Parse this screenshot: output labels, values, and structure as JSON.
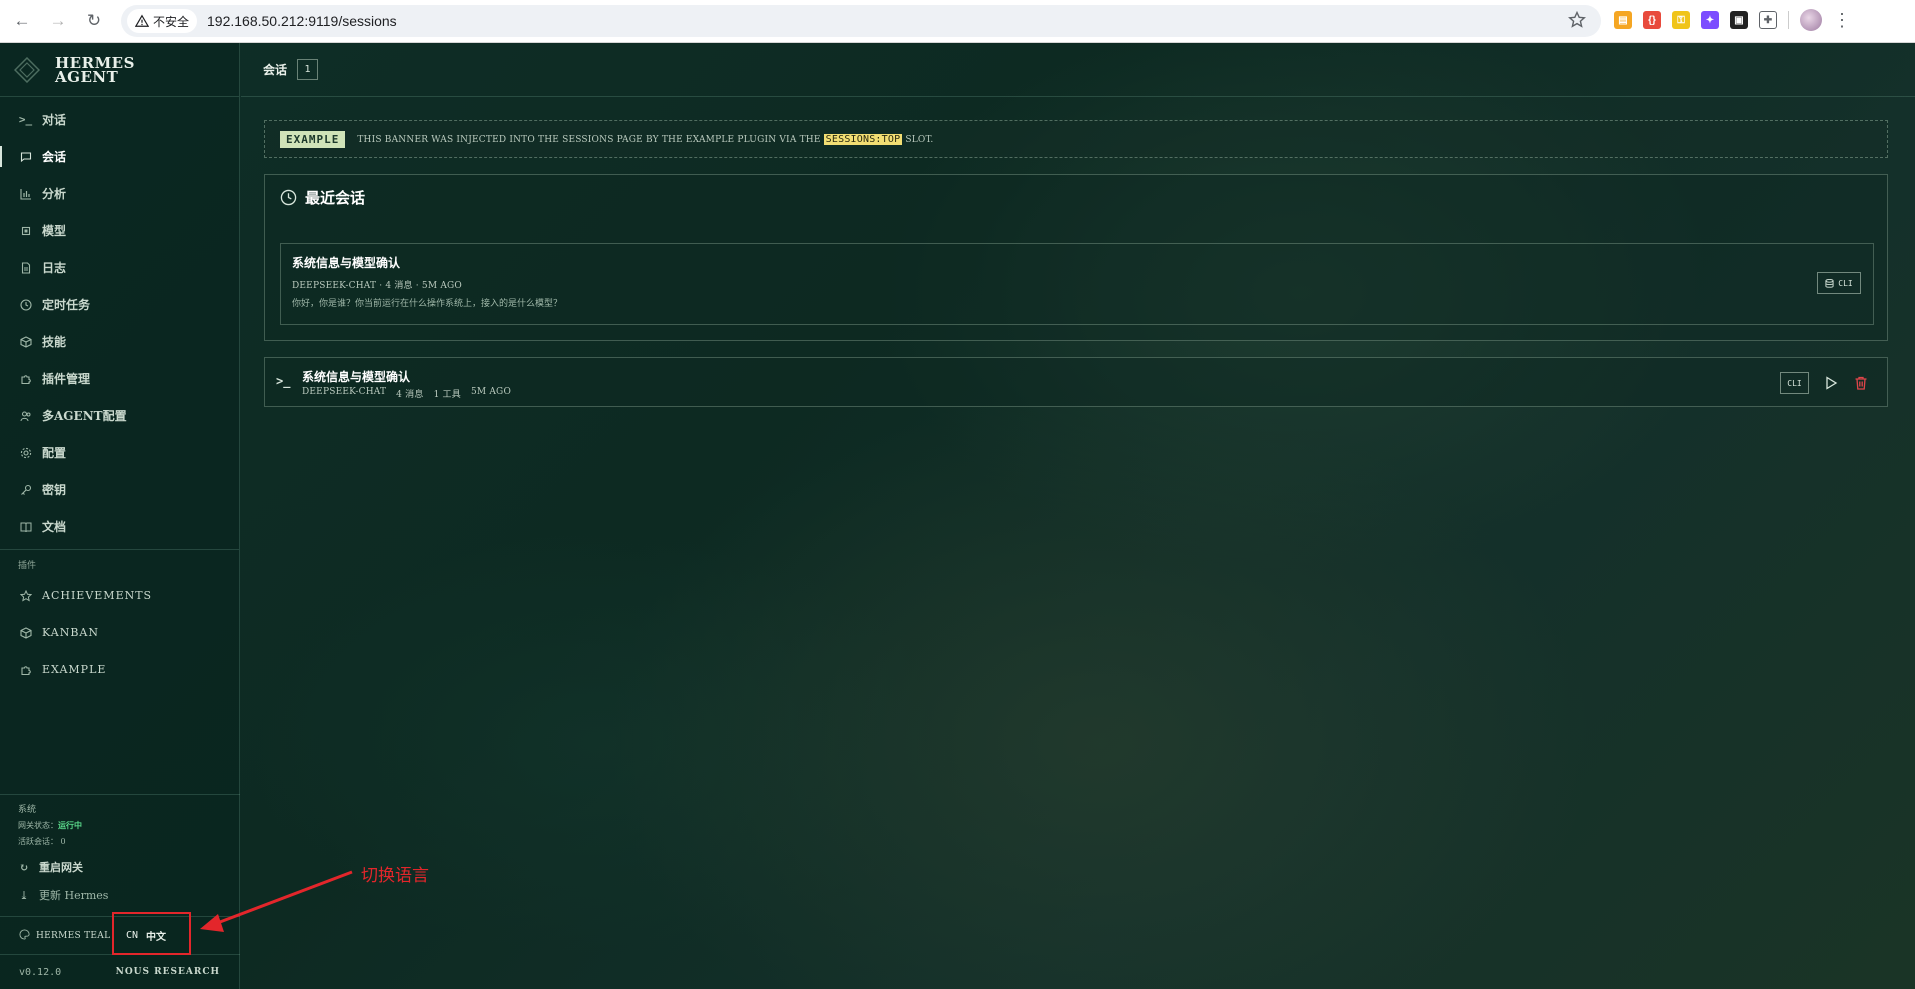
{
  "browser": {
    "security_label": "不安全",
    "url": "192.168.50.212:9119/sessions"
  },
  "brand": {
    "line1": "HERMES",
    "line2": "AGENT"
  },
  "sidebar": {
    "items": [
      {
        "label": "对话",
        "icon": "terminal-icon"
      },
      {
        "label": "会话",
        "icon": "chat-icon"
      },
      {
        "label": "分析",
        "icon": "bar-chart-icon"
      },
      {
        "label": "模型",
        "icon": "cpu-icon"
      },
      {
        "label": "日志",
        "icon": "file-text-icon"
      },
      {
        "label": "定时任务",
        "icon": "clock-icon"
      },
      {
        "label": "技能",
        "icon": "package-icon"
      },
      {
        "label": "插件管理",
        "icon": "puzzle-icon"
      },
      {
        "label": "多AGENT配置",
        "icon": "users-icon"
      },
      {
        "label": "配置",
        "icon": "gear-icon"
      },
      {
        "label": "密钥",
        "icon": "key-icon"
      },
      {
        "label": "文档",
        "icon": "book-icon"
      }
    ],
    "active_index": 1,
    "plugins_label": "插件",
    "plugins": [
      {
        "label": "ACHIEVEMENTS",
        "icon": "star-icon"
      },
      {
        "label": "KANBAN",
        "icon": "package-icon"
      },
      {
        "label": "EXAMPLE",
        "icon": "puzzle-icon"
      }
    ],
    "system": {
      "title": "系统",
      "gateway_label": "网关状态：",
      "gateway_status": "运行中",
      "active_sessions_label": "活跃会话：",
      "active_sessions": "0",
      "restart_label": "重启网关",
      "update_label": "更新 Hermes"
    },
    "theme_label": "HERMES TEAL",
    "lang_code": "CN",
    "lang_label": "中文",
    "version": "v0.12.0",
    "org": "NOUS RESEARCH"
  },
  "topbar": {
    "title": "会话",
    "count": "1"
  },
  "banner": {
    "tag": "EXAMPLE",
    "text_before": "THIS BANNER WAS INJECTED INTO THE SESSIONS PAGE BY THE EXAMPLE PLUGIN VIA THE",
    "slot": "SESSIONS:TOP",
    "text_after": "SLOT."
  },
  "recent": {
    "heading": "最近会话",
    "item": {
      "title": "系统信息与模型确认",
      "meta": "DEEPSEEK-CHAT · 4 消息 · 5M AGO",
      "preview": "你好，你是谁？你当前运行在什么操作系统上，接入的是什么模型？",
      "cli_label": "CLI"
    }
  },
  "sessions": [
    {
      "title": "系统信息与模型确认",
      "model": "DEEPSEEK-CHAT",
      "messages": "4 消息",
      "tools": "1 工具",
      "age": "5M AGO",
      "cli_label": "CLI"
    }
  ],
  "annotation": {
    "text": "切换语言",
    "color": "#e3262b"
  },
  "colors": {
    "accent": "#5bd98b",
    "slot_highlight": "#f2de73",
    "danger": "#e0454a"
  }
}
